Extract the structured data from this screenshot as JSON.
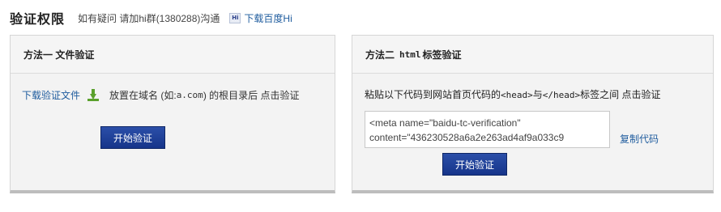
{
  "header": {
    "title": "验证权限",
    "help_text": "如有疑问 请加hi群(1380288)沟通",
    "hi_icon": "hi-icon",
    "download_hi_label": "下载百度Hi"
  },
  "method1": {
    "title": "方法一  文件验证",
    "download_file_label": "下载验证文件",
    "download_icon": "download-arrow-icon",
    "instruction_prefix": "放置在域名 (如:",
    "instruction_domain": "a.com",
    "instruction_suffix": ") 的根目录后 点击验证",
    "verify_button": "开始验证"
  },
  "method2": {
    "title_prefix": "方法二",
    "title_mono": "html",
    "title_suffix": "标签验证",
    "instruction_1": "粘贴以下代码到网站首页代码的",
    "instruction_tag1": "<head>",
    "instruction_2": "与",
    "instruction_tag2": "</head>",
    "instruction_3": "标签之间 点击验证",
    "code_line1": "<meta name=\"baidu-tc-verification\"",
    "code_line2": "content=\"436230528a6a2e263ad4af9a033c9",
    "copy_code_label": "复制代码",
    "verify_button": "开始验证"
  },
  "colors": {
    "link": "#1f5c9e",
    "button": "#1f3f99",
    "download_icon": "#5aa02c"
  }
}
